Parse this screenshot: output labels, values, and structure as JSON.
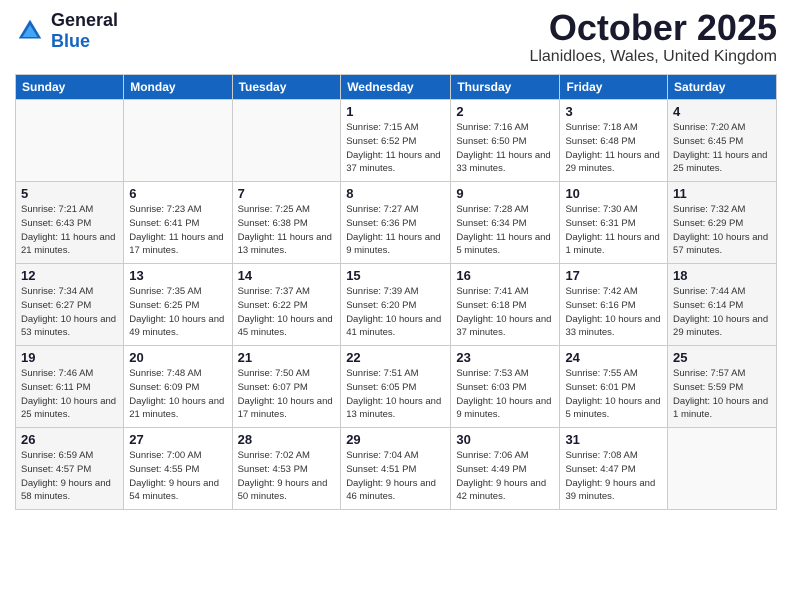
{
  "header": {
    "logo_general": "General",
    "logo_blue": "Blue",
    "month_title": "October 2025",
    "location": "Llanidloes, Wales, United Kingdom"
  },
  "weekdays": [
    "Sunday",
    "Monday",
    "Tuesday",
    "Wednesday",
    "Thursday",
    "Friday",
    "Saturday"
  ],
  "weeks": [
    [
      {
        "day": "",
        "empty": true
      },
      {
        "day": "",
        "empty": true
      },
      {
        "day": "",
        "empty": true
      },
      {
        "day": "1",
        "sunrise": "7:15 AM",
        "sunset": "6:52 PM",
        "daylight": "11 hours and 37 minutes."
      },
      {
        "day": "2",
        "sunrise": "7:16 AM",
        "sunset": "6:50 PM",
        "daylight": "11 hours and 33 minutes."
      },
      {
        "day": "3",
        "sunrise": "7:18 AM",
        "sunset": "6:48 PM",
        "daylight": "11 hours and 29 minutes."
      },
      {
        "day": "4",
        "sunrise": "7:20 AM",
        "sunset": "6:45 PM",
        "daylight": "11 hours and 25 minutes.",
        "weekend": true
      }
    ],
    [
      {
        "day": "5",
        "sunrise": "7:21 AM",
        "sunset": "6:43 PM",
        "daylight": "11 hours and 21 minutes.",
        "weekend": true
      },
      {
        "day": "6",
        "sunrise": "7:23 AM",
        "sunset": "6:41 PM",
        "daylight": "11 hours and 17 minutes."
      },
      {
        "day": "7",
        "sunrise": "7:25 AM",
        "sunset": "6:38 PM",
        "daylight": "11 hours and 13 minutes."
      },
      {
        "day": "8",
        "sunrise": "7:27 AM",
        "sunset": "6:36 PM",
        "daylight": "11 hours and 9 minutes."
      },
      {
        "day": "9",
        "sunrise": "7:28 AM",
        "sunset": "6:34 PM",
        "daylight": "11 hours and 5 minutes."
      },
      {
        "day": "10",
        "sunrise": "7:30 AM",
        "sunset": "6:31 PM",
        "daylight": "11 hours and 1 minute."
      },
      {
        "day": "11",
        "sunrise": "7:32 AM",
        "sunset": "6:29 PM",
        "daylight": "10 hours and 57 minutes.",
        "weekend": true
      }
    ],
    [
      {
        "day": "12",
        "sunrise": "7:34 AM",
        "sunset": "6:27 PM",
        "daylight": "10 hours and 53 minutes.",
        "weekend": true
      },
      {
        "day": "13",
        "sunrise": "7:35 AM",
        "sunset": "6:25 PM",
        "daylight": "10 hours and 49 minutes."
      },
      {
        "day": "14",
        "sunrise": "7:37 AM",
        "sunset": "6:22 PM",
        "daylight": "10 hours and 45 minutes."
      },
      {
        "day": "15",
        "sunrise": "7:39 AM",
        "sunset": "6:20 PM",
        "daylight": "10 hours and 41 minutes."
      },
      {
        "day": "16",
        "sunrise": "7:41 AM",
        "sunset": "6:18 PM",
        "daylight": "10 hours and 37 minutes."
      },
      {
        "day": "17",
        "sunrise": "7:42 AM",
        "sunset": "6:16 PM",
        "daylight": "10 hours and 33 minutes."
      },
      {
        "day": "18",
        "sunrise": "7:44 AM",
        "sunset": "6:14 PM",
        "daylight": "10 hours and 29 minutes.",
        "weekend": true
      }
    ],
    [
      {
        "day": "19",
        "sunrise": "7:46 AM",
        "sunset": "6:11 PM",
        "daylight": "10 hours and 25 minutes.",
        "weekend": true
      },
      {
        "day": "20",
        "sunrise": "7:48 AM",
        "sunset": "6:09 PM",
        "daylight": "10 hours and 21 minutes."
      },
      {
        "day": "21",
        "sunrise": "7:50 AM",
        "sunset": "6:07 PM",
        "daylight": "10 hours and 17 minutes."
      },
      {
        "day": "22",
        "sunrise": "7:51 AM",
        "sunset": "6:05 PM",
        "daylight": "10 hours and 13 minutes."
      },
      {
        "day": "23",
        "sunrise": "7:53 AM",
        "sunset": "6:03 PM",
        "daylight": "10 hours and 9 minutes."
      },
      {
        "day": "24",
        "sunrise": "7:55 AM",
        "sunset": "6:01 PM",
        "daylight": "10 hours and 5 minutes."
      },
      {
        "day": "25",
        "sunrise": "7:57 AM",
        "sunset": "5:59 PM",
        "daylight": "10 hours and 1 minute.",
        "weekend": true
      }
    ],
    [
      {
        "day": "26",
        "sunrise": "6:59 AM",
        "sunset": "4:57 PM",
        "daylight": "9 hours and 58 minutes.",
        "weekend": true
      },
      {
        "day": "27",
        "sunrise": "7:00 AM",
        "sunset": "4:55 PM",
        "daylight": "9 hours and 54 minutes."
      },
      {
        "day": "28",
        "sunrise": "7:02 AM",
        "sunset": "4:53 PM",
        "daylight": "9 hours and 50 minutes."
      },
      {
        "day": "29",
        "sunrise": "7:04 AM",
        "sunset": "4:51 PM",
        "daylight": "9 hours and 46 minutes."
      },
      {
        "day": "30",
        "sunrise": "7:06 AM",
        "sunset": "4:49 PM",
        "daylight": "9 hours and 42 minutes."
      },
      {
        "day": "31",
        "sunrise": "7:08 AM",
        "sunset": "4:47 PM",
        "daylight": "9 hours and 39 minutes."
      },
      {
        "day": "",
        "empty": true,
        "weekend": true
      }
    ]
  ]
}
